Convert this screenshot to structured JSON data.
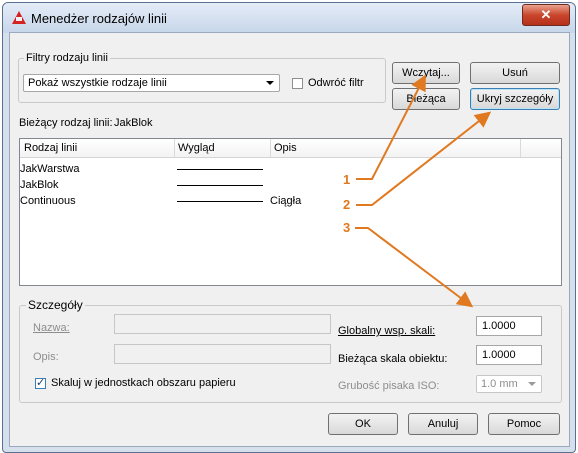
{
  "window": {
    "title": "Menedżer rodzajów linii"
  },
  "filters": {
    "group_label": "Filtry rodzaju linii",
    "select_value": "Pokaż wszystkie rodzaje linii",
    "invert_label": "Odwróć filtr",
    "invert_checked": false
  },
  "buttons": {
    "load": "Wczytaj...",
    "delete": "Usuń",
    "current": "Bieżąca",
    "hide_details": "Ukryj szczegóły"
  },
  "current_linetype": {
    "label": "Bieżący rodzaj linii:",
    "value": "JakBlok"
  },
  "list": {
    "headers": [
      "Rodzaj linii",
      "Wygląd",
      "Opis"
    ],
    "rows": [
      {
        "name": "JakWarstwa",
        "description": ""
      },
      {
        "name": "JakBlok",
        "description": ""
      },
      {
        "name": "Continuous",
        "description": "Ciągła"
      }
    ]
  },
  "details": {
    "group_label": "Szczegóły",
    "name_label": "Nazwa:",
    "desc_label": "Opis:",
    "global_scale_label": "Globalny wsp. skali:",
    "global_scale_value": "1.0000",
    "object_scale_label": "Bieżąca skala obiektu:",
    "object_scale_value": "1.0000",
    "paper_units_label": "Skaluj w jednostkach obszaru papieru",
    "paper_units_checked": true,
    "pen_width_label": "Grubość pisaka ISO:",
    "pen_width_value": "1.0 mm"
  },
  "footer": {
    "ok": "OK",
    "cancel": "Anuluj",
    "help": "Pomoc"
  },
  "callouts": [
    "1",
    "2",
    "3"
  ],
  "colors": {
    "accent": "#e07920",
    "title_bg": "#c7d6ea",
    "close": "#c9462c"
  }
}
